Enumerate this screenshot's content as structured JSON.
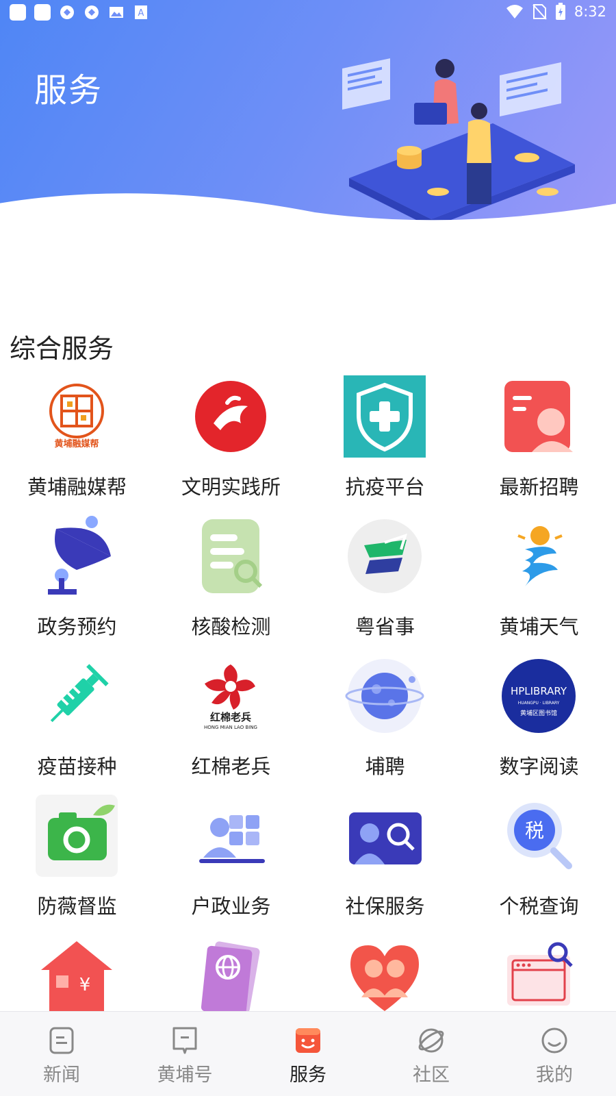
{
  "status_bar": {
    "time": "8:32"
  },
  "header": {
    "title": "服务"
  },
  "section": {
    "title": "综合服务"
  },
  "services": [
    {
      "label": "黄埔融媒帮",
      "icon": "huangpu-media-logo-icon"
    },
    {
      "label": "文明实践所",
      "icon": "civilization-practice-logo-icon"
    },
    {
      "label": "抗疫平台",
      "icon": "shield-cross-icon"
    },
    {
      "label": "最新招聘",
      "icon": "recruitment-card-icon"
    },
    {
      "label": "政务预约",
      "icon": "satellite-dish-icon"
    },
    {
      "label": "核酸检测",
      "icon": "document-search-icon"
    },
    {
      "label": "粤省事",
      "icon": "yue-app-logo-icon"
    },
    {
      "label": "黄埔天气",
      "icon": "weather-swirl-icon"
    },
    {
      "label": "疫苗接种",
      "icon": "syringe-icon"
    },
    {
      "label": "红棉老兵",
      "icon": "red-cotton-veteran-logo-icon"
    },
    {
      "label": "埔聘",
      "icon": "planet-icon"
    },
    {
      "label": "数字阅读",
      "icon": "library-logo-icon"
    },
    {
      "label": "防薇督监",
      "icon": "camera-leaf-icon"
    },
    {
      "label": "户政业务",
      "icon": "person-grid-icon"
    },
    {
      "label": "社保服务",
      "icon": "person-search-icon"
    },
    {
      "label": "个税查询",
      "icon": "tax-search-icon"
    },
    {
      "label": "",
      "icon": "house-yen-icon"
    },
    {
      "label": "",
      "icon": "passport-globe-icon"
    },
    {
      "label": "",
      "icon": "heart-people-icon"
    },
    {
      "label": "",
      "icon": "browser-search-icon"
    }
  ],
  "library_logo_text": {
    "main": "HPLIBRARY",
    "sub": "HUANGPU · LIBRARY",
    "cn": "黄埔区图书馆"
  },
  "media_logo_text": "黄埔融媒帮",
  "veteran_logo_text": {
    "cn": "红棉老兵",
    "en": "HONG MIAN LAO BING"
  },
  "nav": {
    "items": [
      {
        "label": "新闻",
        "icon": "news-icon",
        "active": false
      },
      {
        "label": "黄埔号",
        "icon": "bookmark-icon",
        "active": false
      },
      {
        "label": "服务",
        "icon": "service-face-icon",
        "active": true
      },
      {
        "label": "社区",
        "icon": "planet-ring-icon",
        "active": false
      },
      {
        "label": "我的",
        "icon": "smile-icon",
        "active": false
      }
    ]
  },
  "colors": {
    "banner_start": "#4f86f5",
    "banner_end": "#9a98f8",
    "active_orange": "#f5563a"
  }
}
